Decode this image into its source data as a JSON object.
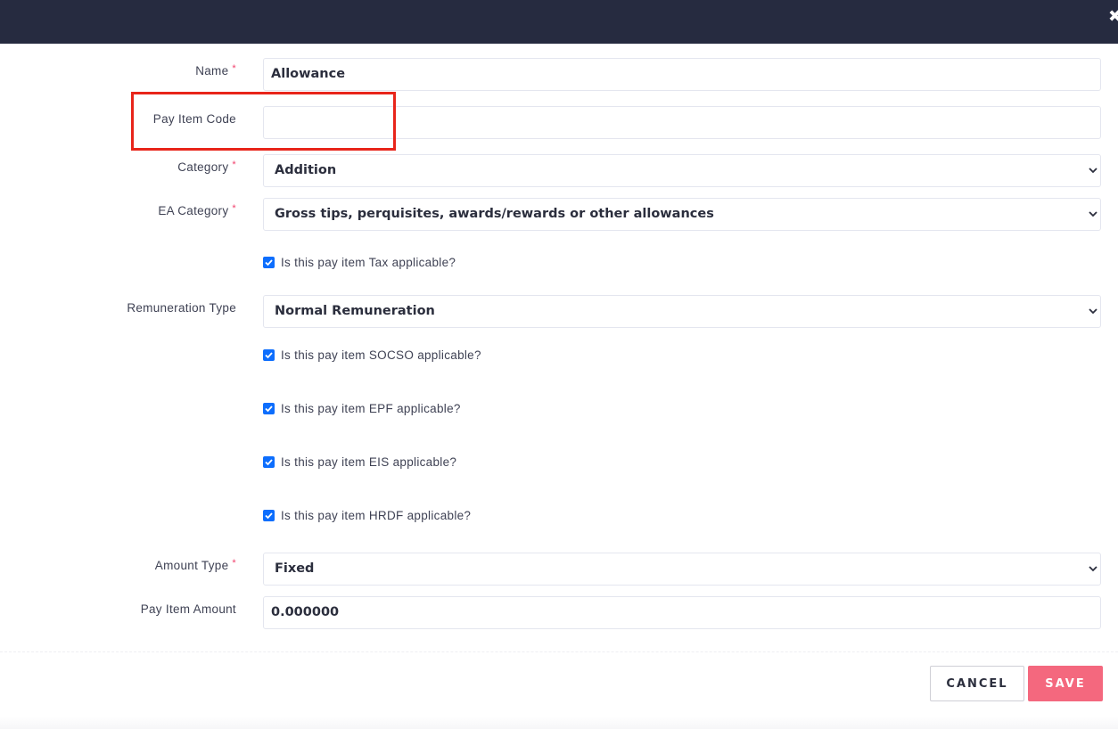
{
  "header": {
    "close_icon": "close-icon"
  },
  "form": {
    "name": {
      "label": "Name",
      "value": "Allowance"
    },
    "pay_item_code": {
      "label": "Pay Item Code",
      "value": ""
    },
    "category": {
      "label": "Category",
      "value": "Addition"
    },
    "ea_category": {
      "label": "EA Category",
      "value": "Gross tips, perquisites, awards/rewards or other allowances"
    },
    "tax_checkbox": {
      "label": "Is this pay item Tax applicable?",
      "checked": true
    },
    "remuneration_type": {
      "label": "Remuneration Type",
      "value": "Normal Remuneration"
    },
    "socso_checkbox": {
      "label": "Is this pay item SOCSO applicable?",
      "checked": true
    },
    "epf_checkbox": {
      "label": "Is this pay item EPF applicable?",
      "checked": true
    },
    "eis_checkbox": {
      "label": "Is this pay item EIS applicable?",
      "checked": true
    },
    "hrdf_checkbox": {
      "label": "Is this pay item HRDF applicable?",
      "checked": true
    },
    "amount_type": {
      "label": "Amount Type",
      "value": "Fixed"
    },
    "pay_item_amount": {
      "label": "Pay Item Amount",
      "value": "0.000000"
    },
    "required_marker": "*"
  },
  "actions": {
    "cancel_label": "CANCEL",
    "save_label": "SAVE"
  },
  "colors": {
    "header_bg": "#262b40",
    "save_bg": "#f4687e",
    "checkbox": "#0d6efd",
    "highlight": "#e8251a",
    "required": "#f1416c"
  }
}
